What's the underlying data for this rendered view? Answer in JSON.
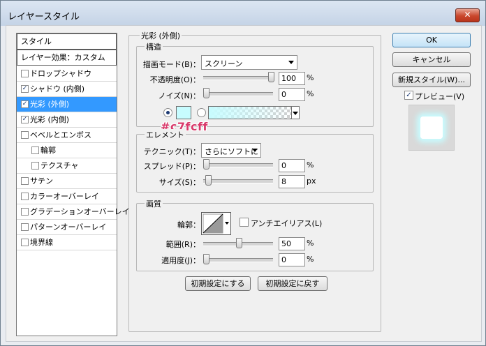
{
  "window": {
    "title": "レイヤースタイル",
    "close_glyph": "✕"
  },
  "sidebar": {
    "header": "スタイル",
    "effects_header": "レイヤー効果：カスタム",
    "items": [
      {
        "label": "ドロップシャドウ",
        "checked": false,
        "indent": false,
        "selected": false
      },
      {
        "label": "シャドウ (内側)",
        "checked": true,
        "indent": false,
        "selected": false
      },
      {
        "label": "光彩 (外側)",
        "checked": true,
        "indent": false,
        "selected": true
      },
      {
        "label": "光彩 (内側)",
        "checked": true,
        "indent": false,
        "selected": false
      },
      {
        "label": "ベベルとエンボス",
        "checked": false,
        "indent": false,
        "selected": false
      },
      {
        "label": "輪郭",
        "checked": false,
        "indent": true,
        "selected": false
      },
      {
        "label": "テクスチャ",
        "checked": false,
        "indent": true,
        "selected": false
      },
      {
        "label": "サテン",
        "checked": false,
        "indent": false,
        "selected": false
      },
      {
        "label": "カラーオーバーレイ",
        "checked": false,
        "indent": false,
        "selected": false
      },
      {
        "label": "グラデーションオーバーレイ",
        "checked": false,
        "indent": false,
        "selected": false
      },
      {
        "label": "パターンオーバーレイ",
        "checked": false,
        "indent": false,
        "selected": false
      },
      {
        "label": "境界線",
        "checked": false,
        "indent": false,
        "selected": false
      }
    ]
  },
  "panel": {
    "title": "光彩 (外側)",
    "structure": {
      "title": "構造",
      "blend_mode_label": "描画モード(B)：",
      "blend_mode_value": "スクリーン",
      "opacity_label": "不透明度(O)：",
      "opacity_value": "100",
      "opacity_unit": "%",
      "opacity_fraction": 1.0,
      "noise_label": "ノイズ(N)：",
      "noise_value": "0",
      "noise_unit": "%",
      "noise_fraction": 0.0,
      "color_selected": "solid",
      "glow_color": "#c7fcff",
      "color_annotation": "#c7fcff"
    },
    "elements": {
      "title": "エレメント",
      "technique_label": "テクニック(T)：",
      "technique_value": "さらにソフトに",
      "spread_label": "スプレッド(P)：",
      "spread_value": "0",
      "spread_unit": "%",
      "spread_fraction": 0.0,
      "size_label": "サイズ(S)：",
      "size_value": "8",
      "size_unit": "px",
      "size_fraction": 0.035
    },
    "quality": {
      "title": "画質",
      "contour_label": "輪郭：",
      "antialias_label": "アンチエイリアス(L)",
      "antialias_checked": false,
      "range_label": "範囲(R)：",
      "range_value": "50",
      "range_unit": "%",
      "range_fraction": 0.5,
      "jitter_label": "適用度(J)：",
      "jitter_value": "0",
      "jitter_unit": "%",
      "jitter_fraction": 0.0
    },
    "make_default": "初期設定にする",
    "reset_default": "初期設定に戻す"
  },
  "actions": {
    "ok": "OK",
    "cancel": "キャンセル",
    "new_style": "新規スタイル(W)...",
    "preview_label": "プレビュー(V)",
    "preview_checked": true
  }
}
